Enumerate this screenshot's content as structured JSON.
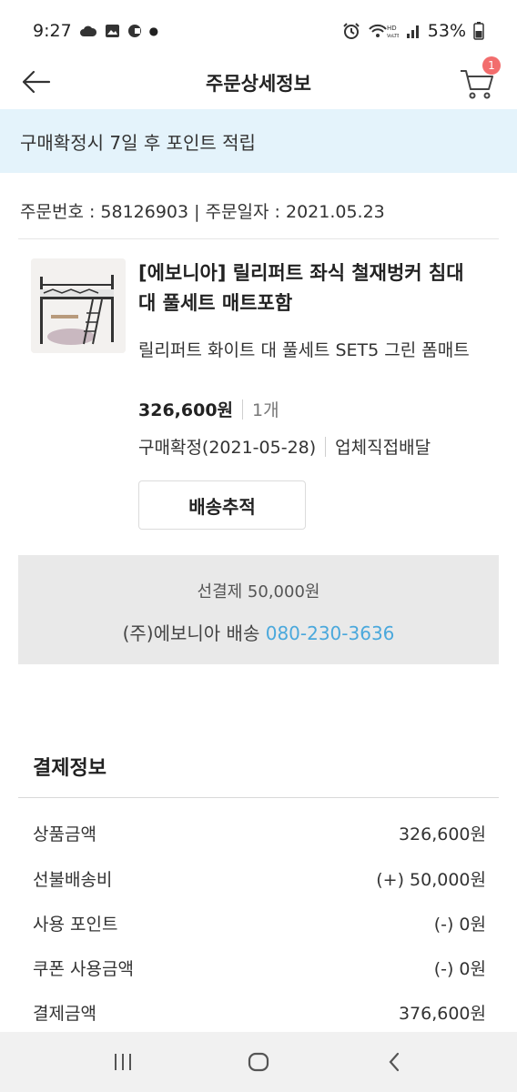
{
  "status_bar": {
    "time": "9:27",
    "battery": "53%"
  },
  "header": {
    "title": "주문상세정보",
    "cart_count": "1"
  },
  "notice": {
    "text": "구매확정시 7일 후 포인트 적립"
  },
  "order": {
    "meta": "주문번호 : 58126903 | 주문일자 : 2021.05.23"
  },
  "product": {
    "name": "[에보니아] 릴리퍼트 좌식 철재벙커 침대 대 풀세트 매트포함",
    "option": "릴리퍼트 화이트 대 풀세트 SET5 그린 폼매트",
    "price": "326,600원",
    "quantity": "1개",
    "status": "구매확정(2021-05-28)",
    "delivery_type": "업체직접배달",
    "track_button": "배송추적"
  },
  "shipping": {
    "prepaid": "선결제 50,000원",
    "vendor": "(주)에보니아 배송",
    "phone": "080-230-3636"
  },
  "payment": {
    "title": "결제정보",
    "rows": [
      {
        "label": "상품금액",
        "value": "326,600원"
      },
      {
        "label": "선불배송비",
        "value": "(+) 50,000원"
      },
      {
        "label": "사용 포인트",
        "value": "(-) 0원"
      },
      {
        "label": "쿠폰 사용금액",
        "value": "(-) 0원"
      },
      {
        "label": "결제금액",
        "value": "376,600원"
      }
    ]
  },
  "colors": {
    "notice_bg": "#e4f3fb",
    "phone_link": "#4aa8dc",
    "badge": "#f26d6d",
    "ship_box_bg": "#e9e9e9"
  },
  "icons": [
    "cloud-icon",
    "image-icon",
    "app-icon",
    "alarm-icon",
    "wifi-icon",
    "signal-icon",
    "battery-icon",
    "back-arrow-icon",
    "cart-icon",
    "recent-apps-icon",
    "home-icon",
    "back-nav-icon"
  ]
}
